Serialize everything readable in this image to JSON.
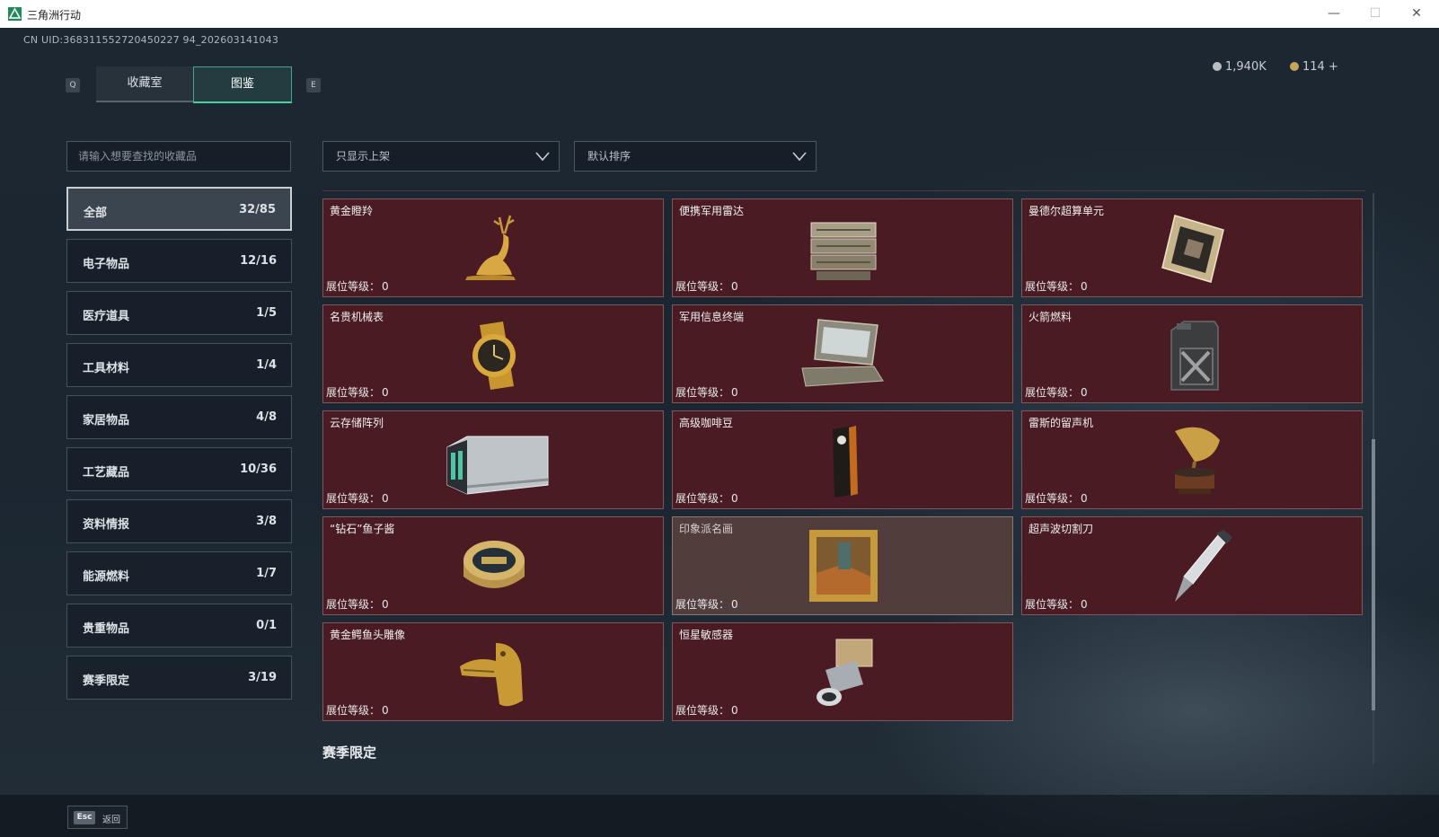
{
  "window": {
    "title": "三角洲行动",
    "minimize": "—",
    "maximize": "☐",
    "close": "✕"
  },
  "header": {
    "uid": "CN UID:368311552720450227 94_202603141043",
    "left_key": "Q",
    "right_key": "E",
    "tabs": [
      {
        "label": "收藏室",
        "active": false
      },
      {
        "label": "图鉴",
        "active": true
      }
    ],
    "currency": [
      {
        "value": "1,940K",
        "color": "#b8bec4"
      },
      {
        "value": "114 +",
        "color": "#c8a45a"
      }
    ]
  },
  "search": {
    "placeholder": "请输入想要查找的收藏品"
  },
  "filters": {
    "shelf": "只显示上架",
    "sort": "默认排序"
  },
  "categories": [
    {
      "label": "全部",
      "count": "32/85",
      "active": true
    },
    {
      "label": "电子物品",
      "count": "12/16"
    },
    {
      "label": "医疗道具",
      "count": "1/5"
    },
    {
      "label": "工具材料",
      "count": "1/4"
    },
    {
      "label": "家居物品",
      "count": "4/8"
    },
    {
      "label": "工艺藏品",
      "count": "10/36"
    },
    {
      "label": "资料情报",
      "count": "3/8"
    },
    {
      "label": "能源燃料",
      "count": "1/7"
    },
    {
      "label": "贵重物品",
      "count": "0/1"
    },
    {
      "label": "赛季限定",
      "count": "3/19"
    }
  ],
  "level_label": "展位等级：",
  "items": [
    {
      "name": "黄金瞪羚",
      "level": "0",
      "icon": "gazelle-icon"
    },
    {
      "name": "便携军用雷达",
      "level": "0",
      "icon": "radar-icon"
    },
    {
      "name": "曼德尔超算单元",
      "level": "0",
      "icon": "cpu-icon"
    },
    {
      "name": "名贵机械表",
      "level": "0",
      "icon": "watch-icon"
    },
    {
      "name": "军用信息终端",
      "level": "0",
      "icon": "terminal-icon"
    },
    {
      "name": "火箭燃料",
      "level": "0",
      "icon": "fuel-can-icon"
    },
    {
      "name": "云存储阵列",
      "level": "0",
      "icon": "storage-array-icon"
    },
    {
      "name": "高级咖啡豆",
      "level": "0",
      "icon": "coffee-bag-icon"
    },
    {
      "name": "雷斯的留声机",
      "level": "0",
      "icon": "gramophone-icon"
    },
    {
      "name": "“钻石”鱼子酱",
      "level": "0",
      "icon": "caviar-tin-icon"
    },
    {
      "name": "印象派名画",
      "level": "0",
      "icon": "painting-icon"
    },
    {
      "name": "超声波切割刀",
      "level": "0",
      "icon": "cutter-icon"
    },
    {
      "name": "黄金鳄鱼头雕像",
      "level": "0",
      "icon": "crocodile-head-icon"
    },
    {
      "name": "恒星敏感器",
      "level": "0",
      "icon": "star-sensor-icon"
    }
  ],
  "section_title": "赛季限定",
  "footer": {
    "esc_key": "Esc",
    "back_label": "返回"
  }
}
